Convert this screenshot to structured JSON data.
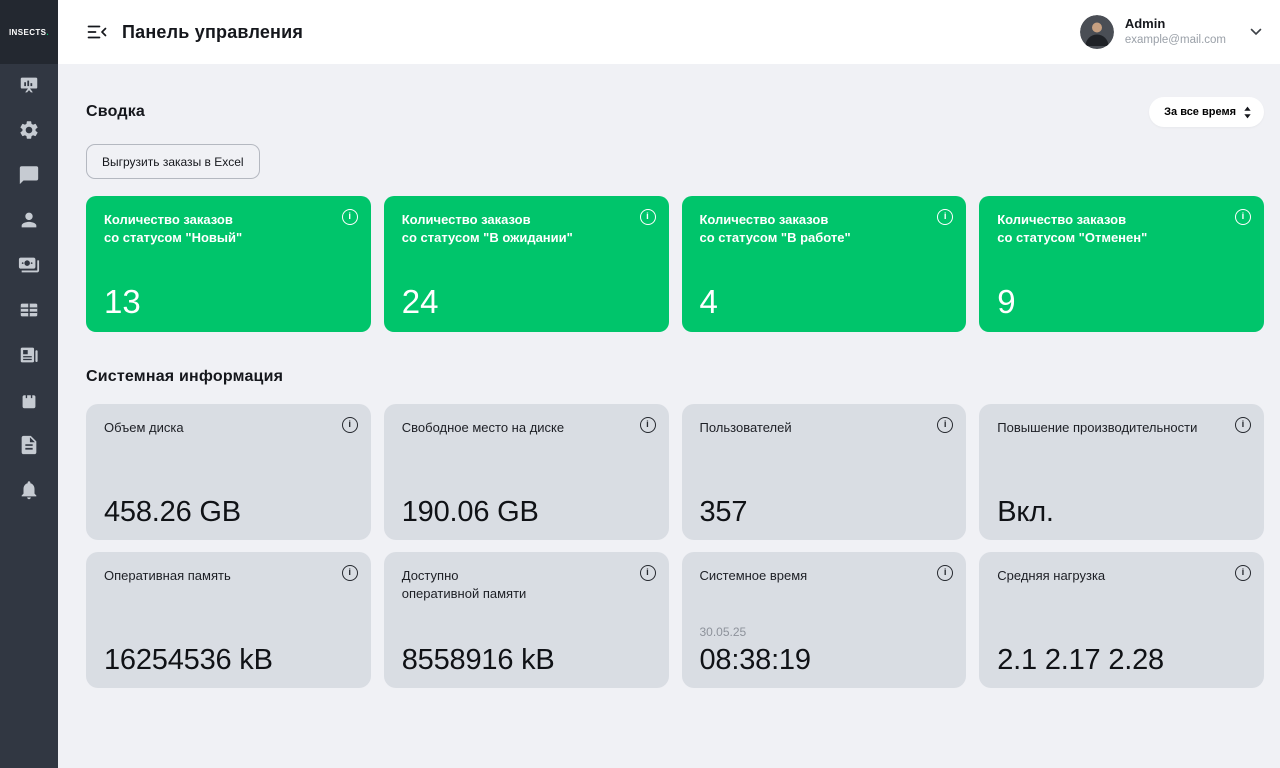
{
  "colors": {
    "accent_green": "#00c56b",
    "sidebar_bg": "#313742",
    "card_gray": "#d9dde3",
    "page_bg": "#f0f1f5"
  },
  "sidebar": {
    "logo_text": "INSECTS",
    "logo_dot": ".",
    "items": [
      {
        "icon": "dashboard-icon"
      },
      {
        "icon": "settings-icon"
      },
      {
        "icon": "chat-icon"
      },
      {
        "icon": "users-icon"
      },
      {
        "icon": "payments-icon"
      },
      {
        "icon": "table-icon"
      },
      {
        "icon": "news-icon"
      },
      {
        "icon": "shopping-bag-icon"
      },
      {
        "icon": "document-icon"
      },
      {
        "icon": "notifications-icon"
      }
    ]
  },
  "header": {
    "title": "Панель управления",
    "user": {
      "name": "Admin",
      "email": "example@mail.com"
    }
  },
  "summary": {
    "heading": "Сводка",
    "period_filter": "За все время",
    "export_button": "Выгрузить заказы в Excel",
    "cards": [
      {
        "title_line1": "Количество заказов",
        "title_line2": "со статусом \"Новый\"",
        "value": "13"
      },
      {
        "title_line1": "Количество заказов",
        "title_line2": "со статусом \"В ожидании\"",
        "value": "24"
      },
      {
        "title_line1": "Количество заказов",
        "title_line2": "со статусом \"В работе\"",
        "value": "4"
      },
      {
        "title_line1": "Количество заказов",
        "title_line2": "со статусом \"Отменен\"",
        "value": "9"
      }
    ]
  },
  "system": {
    "heading": "Системная информация",
    "cards": [
      {
        "title": "Объем диска",
        "value": "458.26 GB"
      },
      {
        "title": "Свободное место на диске",
        "value": "190.06 GB"
      },
      {
        "title": "Пользователей",
        "value": "357"
      },
      {
        "title": "Повышение производительности",
        "value": "Вкл."
      },
      {
        "title": "Оперативная память",
        "value": "16254536 kB"
      },
      {
        "title": "Доступно оперативной памяти",
        "value": "8558916 kB"
      },
      {
        "title": "Системное время",
        "sub_value": "30.05.25",
        "value": "08:38:19"
      },
      {
        "title": "Средняя нагрузка",
        "value": "2.1 2.17 2.28"
      }
    ]
  }
}
